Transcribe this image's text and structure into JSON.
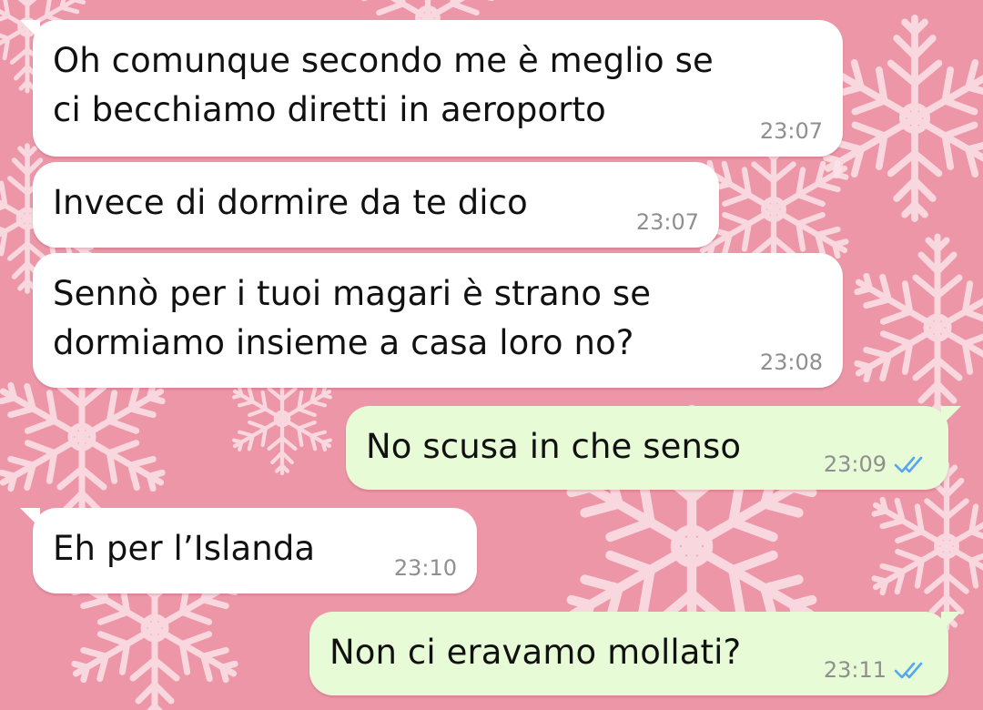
{
  "wallpaper": {
    "background_color": "#ec96a8",
    "pattern": "snowflake-icon"
  },
  "conversation": {
    "messages": [
      {
        "direction": "incoming",
        "text": "Oh comunque secondo me è meglio se\nci becchiamo diretti in aeroporto",
        "time": "23:07"
      },
      {
        "direction": "incoming",
        "text": "Invece di dormire da te dico",
        "time": "23:07"
      },
      {
        "direction": "incoming",
        "text": "Sennò per i tuoi magari è strano se\ndormiamo insieme a casa loro no?",
        "time": "23:08"
      },
      {
        "direction": "outgoing",
        "text": "No scusa in che senso",
        "time": "23:09",
        "status": "read",
        "status_icon": "double-check-icon",
        "status_color": "#53a6f0"
      },
      {
        "direction": "incoming",
        "text": "Eh per l’Islanda",
        "time": "23:10"
      },
      {
        "direction": "outgoing",
        "text": "Non ci eravamo mollati?",
        "time": "23:11",
        "status": "read",
        "status_icon": "double-check-icon",
        "status_color": "#53a6f0"
      }
    ]
  },
  "colors": {
    "incoming_bubble": "#ffffff",
    "outgoing_bubble": "#e7fbd6",
    "timestamp": "#8f8f8f",
    "read_ticks": "#53a6f0"
  }
}
